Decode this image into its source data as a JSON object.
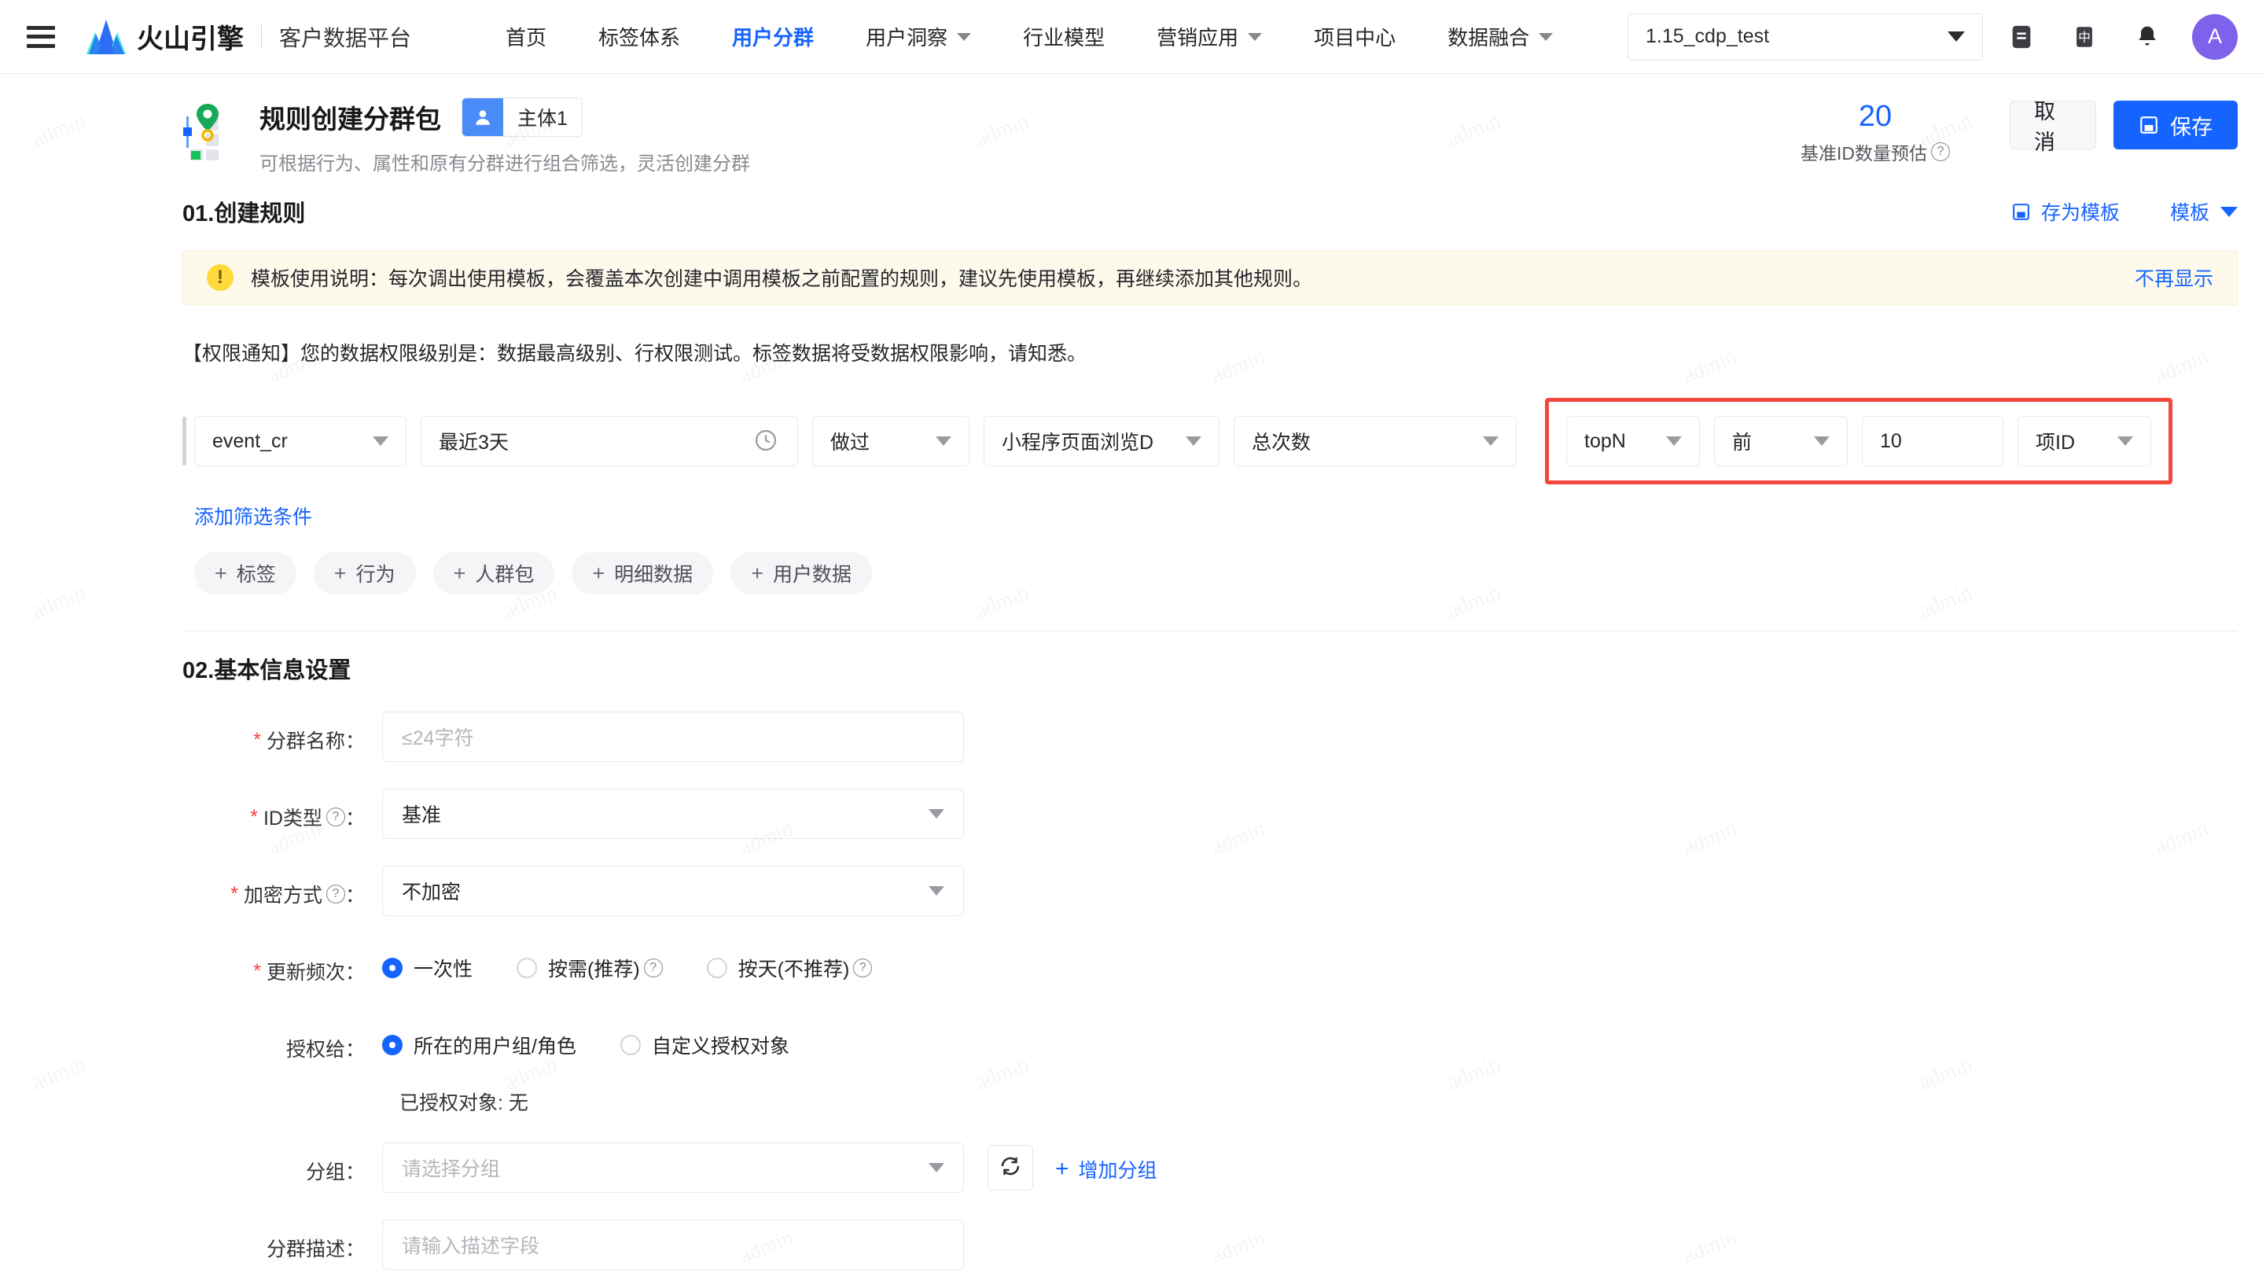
{
  "topnav": {
    "menu_icon": "hamburger-icon",
    "brand": "火山引擎",
    "brand_sub": "客户数据平台",
    "links": [
      {
        "label": "首页",
        "active": false,
        "caret": false
      },
      {
        "label": "标签体系",
        "active": false,
        "caret": false
      },
      {
        "label": "用户分群",
        "active": true,
        "caret": false
      },
      {
        "label": "用户洞察",
        "active": false,
        "caret": true
      },
      {
        "label": "行业模型",
        "active": false,
        "caret": false
      },
      {
        "label": "营销应用",
        "active": false,
        "caret": true
      },
      {
        "label": "项目中心",
        "active": false,
        "caret": false
      },
      {
        "label": "数据融合",
        "active": false,
        "caret": true
      }
    ],
    "project": "1.15_cdp_test",
    "icons": [
      "workspace-icon",
      "language-icon",
      "bell-icon"
    ],
    "avatar": "A"
  },
  "page_header": {
    "title": "规则创建分群包",
    "subject_chip": "主体1",
    "description": "可根据行为、属性和原有分群进行组合筛选，灵活创建分群",
    "estimate_value": "20",
    "estimate_label": "基准ID数量预估",
    "cancel_label": "取消",
    "save_label": "保存"
  },
  "section1": {
    "title": "01.创建规则",
    "save_template": "存为模板",
    "template_dropdown": "模板",
    "notice_text": "模板使用说明：每次调出使用模板，会覆盖本次创建中调用模板之前配置的规则，建议先使用模板，再继续添加其他规则。",
    "notice_dismiss": "不再显示",
    "permission_note": "【权限通知】您的数据权限级别是：数据最高级别、行权限测试。标签数据将受数据权限影响，请知悉。",
    "rule": {
      "event": "event_cr",
      "date_range": "最近3天",
      "did": "做过",
      "event_name": "小程序页面浏览D",
      "aggregate": "总次数",
      "topn_mode": "topN",
      "direction": "前",
      "count": "10",
      "id_field": "项ID"
    },
    "add_condition": "添加筛选条件",
    "chips": [
      "标签",
      "行为",
      "人群包",
      "明细数据",
      "用户数据"
    ]
  },
  "section2": {
    "title": "02.基本信息设置",
    "fields": {
      "name_label": "分群名称：",
      "name_placeholder": "≤24字符",
      "idtype_label": "ID类型",
      "idtype_value": "基准",
      "encrypt_label": "加密方式",
      "encrypt_value": "不加密",
      "freq_label": "更新频次：",
      "freq_options": [
        "一次性",
        "按需(推荐)",
        "按天(不推荐)"
      ],
      "freq_selected": 0,
      "grant_label": "授权给：",
      "grant_options": [
        "所在的用户组/角色",
        "自定义授权对象"
      ],
      "grant_selected": 0,
      "granted_objects": "已授权对象: 无",
      "group_label": "分组：",
      "group_placeholder": "请选择分组",
      "refresh_icon": "refresh-icon",
      "add_group": "增加分组",
      "desc_label": "分群描述：",
      "desc_placeholder": "请输入描述字段"
    }
  },
  "colors": {
    "accent": "#1664ff",
    "highlight_box": "#f4473d",
    "notice_bg": "#fdfaec",
    "avatar_bg": "#7f62ec"
  }
}
